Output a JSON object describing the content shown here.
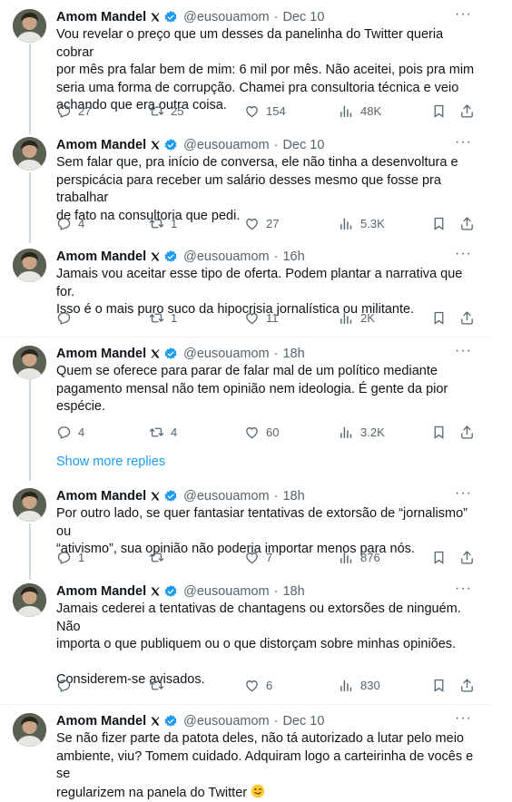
{
  "author": {
    "name": "Amom Mandel",
    "handle": "@eusouamom"
  },
  "more_label": "···",
  "show_more_replies": "Show more replies",
  "tweets": [
    {
      "time": "Dec 10",
      "text": "Vou revelar o preço que um desses da panelinha do Twitter queria cobrar\npor mês pra falar bem de mim: 6 mil por mês. Não aceitei, pois pra mim\nseria uma forma de corrupção. Chamei pra consultoria técnica e veio\nachando que era outra coisa.",
      "replies": "27",
      "retweets": "25",
      "likes": "154",
      "views": "48K"
    },
    {
      "time": "Dec 10",
      "text": "Sem falar que, pra início de conversa, ele não tinha a desenvoltura e\nperspicácia para receber um salário desses mesmo que fosse pra trabalhar\nde fato na consultoria que pedi.",
      "replies": "4",
      "retweets": "1",
      "likes": "27",
      "views": "5.3K"
    },
    {
      "time": "16h",
      "text": "Jamais vou aceitar esse tipo de oferta. Podem plantar a narrativa que for.\nIsso é o mais puro suco da hipocrisia jornalística ou militante.",
      "replies": "",
      "retweets": "1",
      "likes": "11",
      "views": "2K"
    },
    {
      "time": "18h",
      "text": "Quem se oferece para parar de falar mal de um político mediante\npagamento mensal não tem opinião nem ideologia. É gente da pior\nespécie.",
      "replies": "4",
      "retweets": "4",
      "likes": "60",
      "views": "3.2K"
    },
    {
      "time": "18h",
      "text": "Por outro lado, se quer fantasiar tentativas de extorsão de “jornalismo” ou\n“ativismo”, sua opinião não poderia importar menos para nós.",
      "replies": "1",
      "retweets": "",
      "likes": "7",
      "views": "876"
    },
    {
      "time": "18h",
      "text": "Jamais cederei a tentativas de chantagens ou extorsões de ninguém. Não\nimporta o que publiquem ou o que distorçam sobre minhas opiniões.\n\nConsiderem-se avisados.",
      "replies": "",
      "retweets": "",
      "likes": "6",
      "views": "830"
    },
    {
      "time": "Dec 10",
      "text": "Se não fizer parte da patota deles, não tá autorizado a lutar pelo meio\nambiente, viu? Tomem cuidado. Adquiram logo a carteirinha de vocês e se\nregularizem na panela do Twitter",
      "emoji": "winking-face-with-tongue"
    }
  ],
  "colors": {
    "text": "#0f1419",
    "muted": "#536471",
    "accent": "#1d9bf0",
    "thread_line": "#cfd9de"
  }
}
